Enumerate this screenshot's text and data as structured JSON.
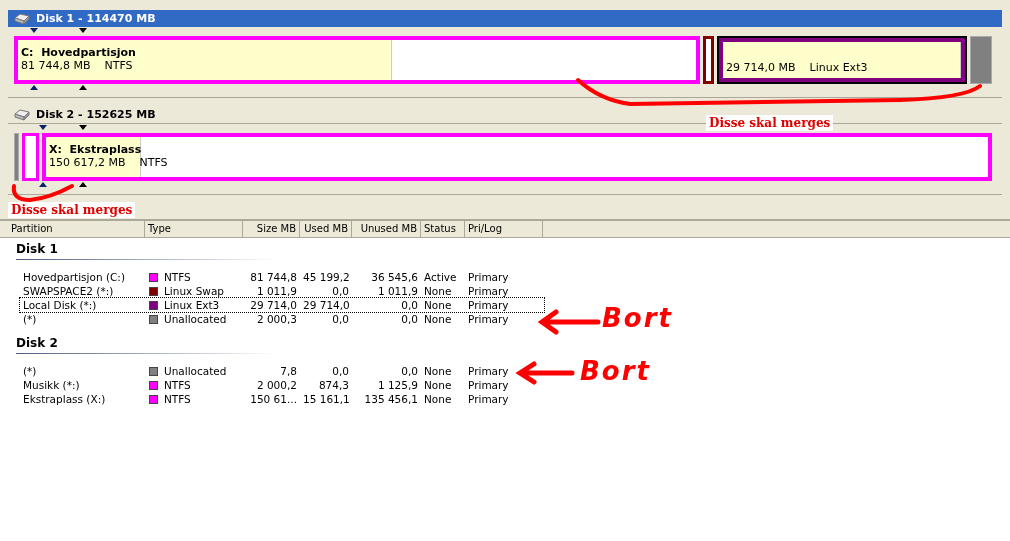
{
  "disks": [
    {
      "title": "Disk 1 - 114470 MB",
      "selected": true,
      "partitions": [
        {
          "kind": "partition",
          "color": "#ff00ff",
          "level": 0.55,
          "drive": "C:",
          "name": "Hovedpartisjon",
          "size": "81 744,8 MB",
          "fs": "NTFS"
        },
        {
          "kind": "partition",
          "color": "#800000"
        },
        {
          "kind": "partition",
          "color": "#800080",
          "level": 1,
          "size": "29 714,0 MB",
          "fs": "Linux Ext3",
          "selected": true
        },
        {
          "kind": "unallocated",
          "color": "#808080"
        }
      ]
    },
    {
      "title": "Disk 2 - 152625 MB",
      "selected": false,
      "partitions": [
        {
          "kind": "unallocated",
          "color": "#808080"
        },
        {
          "kind": "partition",
          "color": "#ff00ff"
        },
        {
          "kind": "partition",
          "color": "#ff00ff",
          "level": 0.1,
          "drive": "X:",
          "name": "Ekstraplass",
          "size": "150 617,2 MB",
          "fs": "NTFS"
        }
      ]
    }
  ],
  "table": {
    "columns": [
      "Partition",
      "Type",
      "Size MB",
      "Used MB",
      "Unused MB",
      "Status",
      "Pri/Log"
    ],
    "groups": [
      {
        "title": "Disk 1",
        "rows": [
          {
            "partition": "Hovedpartisjon (C:)",
            "color": "#ff00ff",
            "type": "NTFS",
            "size": "81 744,8",
            "used": "45 199,2",
            "unused": "36 545,6",
            "status": "Active",
            "prilog": "Primary",
            "selected": false
          },
          {
            "partition": "SWAPSPACE2 (*:)",
            "color": "#800000",
            "type": "Linux Swap",
            "size": "1 011,9",
            "used": "0,0",
            "unused": "1 011,9",
            "status": "None",
            "prilog": "Primary",
            "selected": false
          },
          {
            "partition": "Local Disk (*:)",
            "color": "#800080",
            "type": "Linux Ext3",
            "size": "29 714,0",
            "used": "29 714,0",
            "unused": "0,0",
            "status": "None",
            "prilog": "Primary",
            "selected": true
          },
          {
            "partition": "(*)",
            "color": "#808080",
            "type": "Unallocated",
            "size": "2 000,3",
            "used": "0,0",
            "unused": "0,0",
            "status": "None",
            "prilog": "Primary",
            "selected": false
          }
        ]
      },
      {
        "title": "Disk 2",
        "rows": [
          {
            "partition": "(*)",
            "color": "#808080",
            "type": "Unallocated",
            "size": "7,8",
            "used": "0,0",
            "unused": "0,0",
            "status": "None",
            "prilog": "Primary",
            "selected": false
          },
          {
            "partition": "Musikk (*:)",
            "color": "#ff00ff",
            "type": "NTFS",
            "size": "2 000,2",
            "used": "874,3",
            "unused": "1 125,9",
            "status": "None",
            "prilog": "Primary",
            "selected": false
          },
          {
            "partition": "Ekstraplass (X:)",
            "color": "#ff00ff",
            "type": "NTFS",
            "size": "150 61...",
            "used": "15 161,1",
            "unused": "135 456,1",
            "status": "None",
            "prilog": "Primary",
            "selected": false
          }
        ]
      }
    ]
  },
  "annotations": [
    {
      "kind": "merge-note",
      "text": "Disse skal merges"
    },
    {
      "kind": "merge-note",
      "text": "Disse skal merges"
    },
    {
      "kind": "remove-note",
      "text": "Bort"
    },
    {
      "kind": "remove-note",
      "text": "Bort"
    }
  ]
}
